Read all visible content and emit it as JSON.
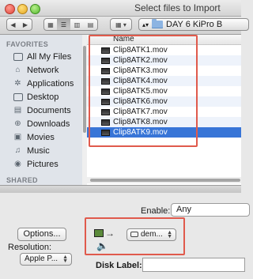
{
  "window": {
    "title": "Select files to Import"
  },
  "toolbar": {
    "back_icon": "back-arrow-icon",
    "forward_icon": "forward-arrow-icon",
    "view_icons": [
      "icon-view-icon",
      "list-view-icon",
      "column-view-icon",
      "coverflow-view-icon"
    ],
    "path_folder": "DAY 6 KiPro B"
  },
  "sidebar": {
    "favorites_header": "FAVORITES",
    "items": [
      {
        "label": "All My Files",
        "icon": "all-files-icon"
      },
      {
        "label": "Network",
        "icon": "network-icon"
      },
      {
        "label": "Applications",
        "icon": "applications-icon"
      },
      {
        "label": "Desktop",
        "icon": "desktop-icon"
      },
      {
        "label": "Documents",
        "icon": "documents-icon"
      },
      {
        "label": "Downloads",
        "icon": "downloads-icon"
      },
      {
        "label": "Movies",
        "icon": "movies-icon"
      },
      {
        "label": "Music",
        "icon": "music-icon"
      },
      {
        "label": "Pictures",
        "icon": "pictures-icon"
      }
    ],
    "shared_header": "SHARED"
  },
  "files": {
    "column_name": "Name",
    "items": [
      "Clip8ATK1.mov",
      "Clip8ATK2.mov",
      "Clip8ATK3.mov",
      "Clip8ATK4.mov",
      "Clip8ATK5.mov",
      "Clip8ATK6.mov",
      "Clip8ATK7.mov",
      "Clip8ATK8.mov",
      "Clip8ATK9.mov"
    ],
    "selected_index": 8
  },
  "import_options": {
    "enable_label": "Enable:",
    "enable_value": "Any",
    "options_button": "Options...",
    "resolution_label": "Resolution:",
    "resolution_value": "Apple P...",
    "route_value": "dem...",
    "disk_label": "Disk Label:",
    "disk_value": ""
  },
  "colors": {
    "selection": "#3875d7",
    "highlight_box": "#e05a4c"
  }
}
